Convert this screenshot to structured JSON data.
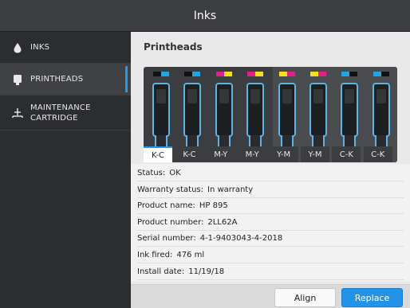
{
  "window": {
    "title": "Inks"
  },
  "sidebar": {
    "items": [
      {
        "label": "INKS",
        "icon": "ink-drop-icon",
        "selected": false
      },
      {
        "label": "PRINTHEADS",
        "icon": "printhead-icon",
        "selected": true
      },
      {
        "label": "MAINTENANCE CARTRIDGE",
        "icon": "maintenance-cartridge-icon",
        "selected": false
      }
    ]
  },
  "main": {
    "title": "Printheads",
    "printheads": [
      {
        "label": "K-C",
        "colors": [
          "#111111",
          "#21a4e4"
        ],
        "selected": true
      },
      {
        "label": "K-C",
        "colors": [
          "#111111",
          "#21a4e4"
        ],
        "selected": false
      },
      {
        "label": "M-Y",
        "colors": [
          "#e0218a",
          "#f2e21b"
        ],
        "selected": false
      },
      {
        "label": "M-Y",
        "colors": [
          "#e0218a",
          "#f2e21b"
        ],
        "selected": false
      },
      {
        "label": "Y-M",
        "colors": [
          "#f2e21b",
          "#e0218a"
        ],
        "selected": false
      },
      {
        "label": "Y-M",
        "colors": [
          "#f2e21b",
          "#e0218a"
        ],
        "selected": false
      },
      {
        "label": "C-K",
        "colors": [
          "#21a4e4",
          "#111111"
        ],
        "selected": false
      },
      {
        "label": "C-K",
        "colors": [
          "#21a4e4",
          "#111111"
        ],
        "selected": false
      }
    ],
    "info": [
      {
        "key": "Status:",
        "value": "OK"
      },
      {
        "key": "Warranty status:",
        "value": "In warranty"
      },
      {
        "key": "Product name:",
        "value": "HP 895"
      },
      {
        "key": "Product number:",
        "value": "2LL62A"
      },
      {
        "key": "Serial number:",
        "value": "4-1-9403043-4-2018"
      },
      {
        "key": "Ink fired:",
        "value": "476 ml"
      },
      {
        "key": "Install date:",
        "value": "11/19/18"
      }
    ],
    "buttons": {
      "align": "Align",
      "replace": "Replace"
    }
  },
  "colors": {
    "accent": "#2293e6",
    "selection": "#1e9cf0",
    "printhead_border": "#5eb3e4"
  }
}
